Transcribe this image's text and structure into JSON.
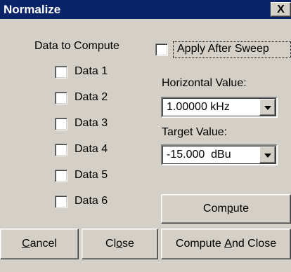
{
  "window": {
    "title": "Normalize",
    "close_glyph": "X"
  },
  "data_section": {
    "heading": "Data to Compute",
    "items": [
      {
        "label": "Data 1",
        "checked": false
      },
      {
        "label": "Data 2",
        "checked": false
      },
      {
        "label": "Data 3",
        "checked": false
      },
      {
        "label": "Data 4",
        "checked": false
      },
      {
        "label": "Data 5",
        "checked": false
      },
      {
        "label": "Data 6",
        "checked": false
      }
    ]
  },
  "apply_after_sweep": {
    "label": "Apply After Sweep",
    "checked": false
  },
  "horizontal": {
    "label": "Horizontal Value:",
    "value": "1.00000 kHz"
  },
  "target": {
    "label": "Target Value:",
    "value": "-15.000  dBu"
  },
  "buttons": {
    "compute": {
      "pre": "Com",
      "mnemonic": "p",
      "post": "ute"
    },
    "cancel": {
      "pre": "",
      "mnemonic": "C",
      "post": "ancel"
    },
    "close": {
      "pre": "Cl",
      "mnemonic": "o",
      "post": "se"
    },
    "compute_and_close": {
      "pre": "Compute ",
      "mnemonic": "A",
      "post": "nd Close"
    }
  },
  "colors": {
    "titlebar": "#0a246a",
    "face": "#d4d0c8"
  }
}
